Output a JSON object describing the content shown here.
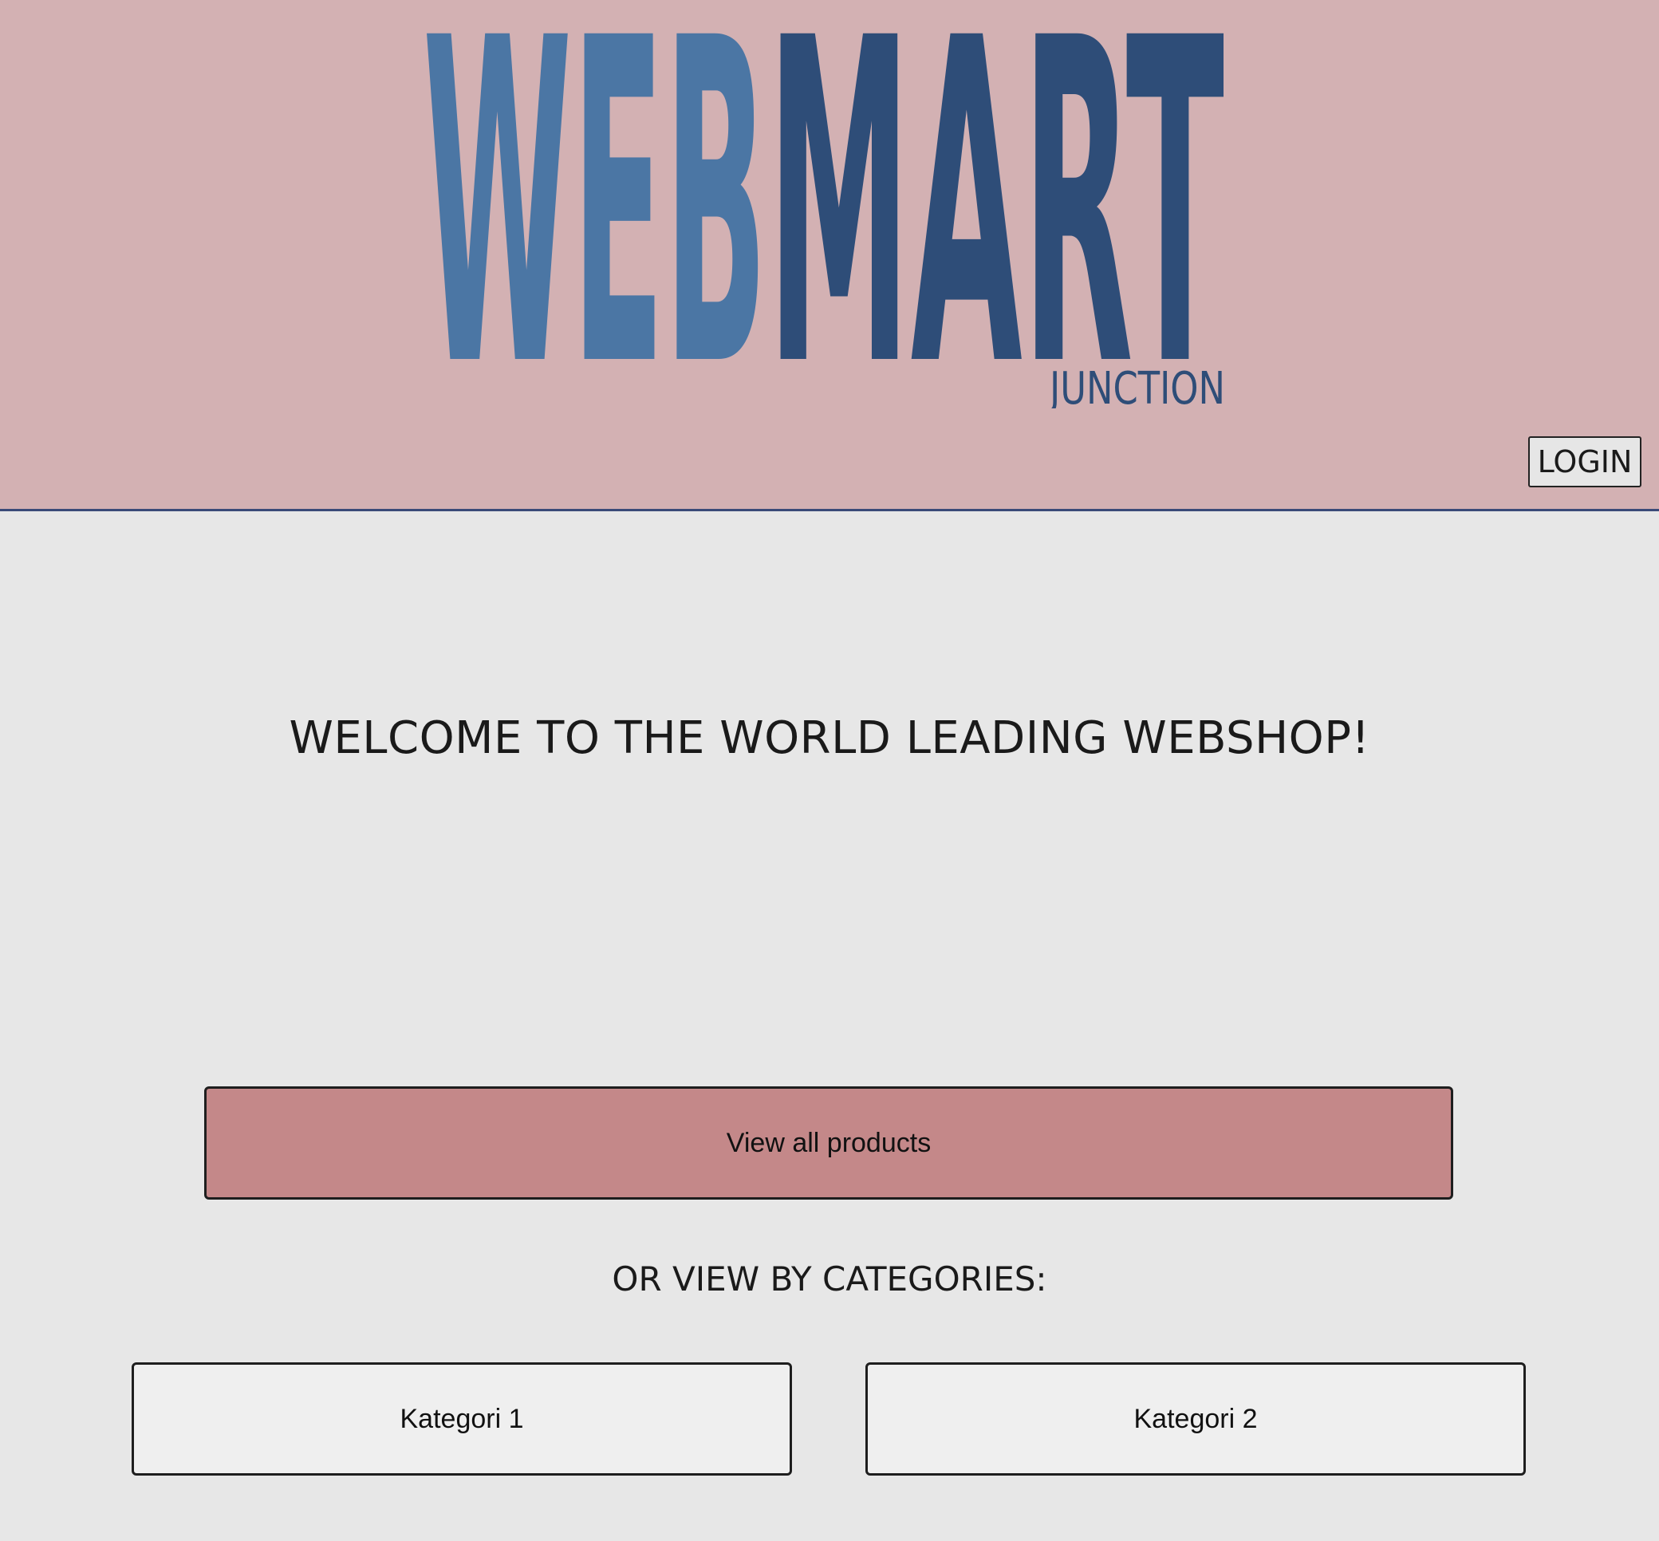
{
  "brand": {
    "logo_word_1": "WEB",
    "logo_word_2": "MART",
    "logo_sub": "JUNCTION"
  },
  "header": {
    "login_label": "LOGIN"
  },
  "main": {
    "welcome_text": "WELCOME TO THE WORLD LEADING WEBSHOP!",
    "view_all_label": "View all products",
    "categories_heading": "OR VIEW BY CATEGORIES:",
    "categories": [
      {
        "label": "Kategori 1"
      },
      {
        "label": "Kategori 2"
      }
    ]
  },
  "colors": {
    "header_bg": "#d3b1b3",
    "page_bg": "#e7e7e7",
    "logo_light_blue": "#4b76a4",
    "logo_dark_blue": "#2e4d78",
    "primary_button": "#c48889",
    "category_button": "#efefef"
  }
}
